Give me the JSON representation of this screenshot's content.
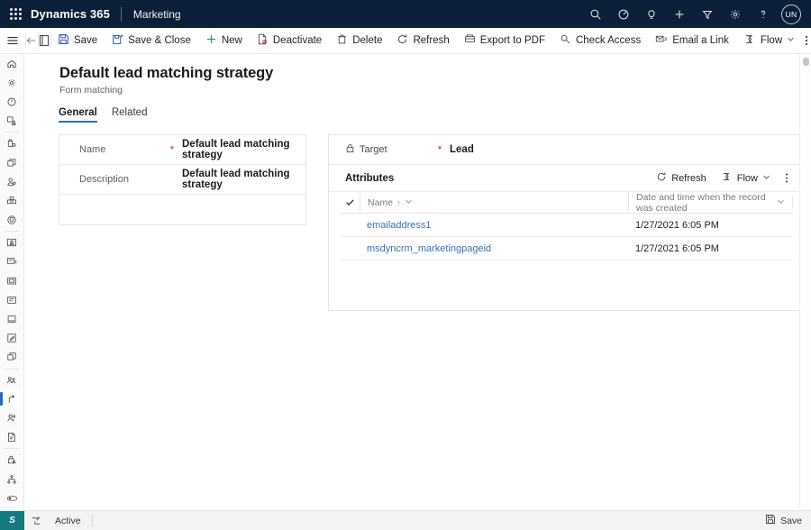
{
  "topnav": {
    "waffle_icon": "app-launcher-icon",
    "brand": "Dynamics 365",
    "app_name": "Marketing",
    "icons": [
      {
        "name": "search-icon",
        "label": "Search"
      },
      {
        "name": "focus-assist-icon",
        "label": "Focused"
      },
      {
        "name": "lightbulb-icon",
        "label": "Assistant"
      },
      {
        "name": "add-icon",
        "label": "New"
      },
      {
        "name": "filter-icon",
        "label": "Filter"
      },
      {
        "name": "settings-gear-icon",
        "label": "Settings"
      },
      {
        "name": "help-question-icon",
        "label": "Help"
      }
    ],
    "avatar_initials": "UN"
  },
  "commandbar": {
    "hamburger_label": "Site map",
    "back_label": "Back",
    "form_icon_label": "Form",
    "buttons": [
      {
        "name": "save-button",
        "label": "Save",
        "icon": "save-icon"
      },
      {
        "name": "save-and-close-button",
        "label": "Save & Close",
        "icon": "save-close-icon"
      },
      {
        "name": "new-button",
        "label": "New",
        "icon": "plus-icon"
      },
      {
        "name": "deactivate-button",
        "label": "Deactivate",
        "icon": "deactivate-icon"
      },
      {
        "name": "delete-button",
        "label": "Delete",
        "icon": "trash-icon"
      },
      {
        "name": "refresh-button",
        "label": "Refresh",
        "icon": "refresh-icon"
      },
      {
        "name": "export-to-pdf-button",
        "label": "Export to PDF",
        "icon": "pdf-icon"
      },
      {
        "name": "check-access-button",
        "label": "Check Access",
        "icon": "key-icon"
      },
      {
        "name": "email-a-link-button",
        "label": "Email a Link",
        "icon": "email-link-icon"
      },
      {
        "name": "flow-button",
        "label": "Flow",
        "icon": "flow-icon",
        "has_chevron": true
      }
    ],
    "overflow_label": "More commands"
  },
  "sidebar": {
    "items": [
      {
        "name": "sidebar-item-home",
        "icon": "home-icon",
        "selected": false
      },
      {
        "name": "sidebar-item-settings",
        "icon": "gear-icon",
        "selected": false
      },
      {
        "name": "sidebar-item-recent",
        "icon": "clock-icon",
        "selected": false
      },
      {
        "name": "sidebar-item-pinned",
        "icon": "pin-person-icon",
        "selected": false
      },
      {
        "name": "sidebar-item-accounts",
        "icon": "briefcase-gear-icon",
        "selected": false,
        "group_start": true
      },
      {
        "name": "sidebar-item-pages",
        "icon": "copy-pages-icon",
        "selected": false
      },
      {
        "name": "sidebar-item-contacts",
        "icon": "person-gear-icon",
        "selected": false
      },
      {
        "name": "sidebar-item-segments",
        "icon": "segments-icon",
        "selected": false
      },
      {
        "name": "sidebar-item-security",
        "icon": "shield-icon",
        "selected": false
      },
      {
        "name": "sidebar-item-customer-journey",
        "icon": "journey-card-icon",
        "selected": false,
        "group_start": true
      },
      {
        "name": "sidebar-item-marketing-email",
        "icon": "email-card-icon",
        "selected": false
      },
      {
        "name": "sidebar-item-marketing-page",
        "icon": "page-card-icon",
        "selected": false
      },
      {
        "name": "sidebar-item-marketing-form",
        "icon": "form-card-icon",
        "selected": false
      },
      {
        "name": "sidebar-item-forms-hosted",
        "icon": "laptop-icon",
        "selected": false
      },
      {
        "name": "sidebar-item-form-editor",
        "icon": "edit-square-icon",
        "selected": false
      },
      {
        "name": "sidebar-item-templates",
        "icon": "layers-icon",
        "selected": false
      },
      {
        "name": "sidebar-item-events",
        "icon": "people-network-icon",
        "selected": false,
        "group_start": true
      },
      {
        "name": "sidebar-item-lead-matching",
        "icon": "branch-arrow-icon",
        "selected": true
      },
      {
        "name": "sidebar-item-leads",
        "icon": "people-search-icon",
        "selected": false
      },
      {
        "name": "sidebar-item-reports",
        "icon": "report-doc-icon",
        "selected": false
      },
      {
        "name": "sidebar-item-data-config",
        "icon": "lock-gear-icon",
        "selected": false,
        "group_start": true
      },
      {
        "name": "sidebar-item-hierarchy",
        "icon": "org-chart-icon",
        "selected": false
      },
      {
        "name": "sidebar-item-toggle",
        "icon": "toggle-icon",
        "selected": false
      }
    ]
  },
  "page": {
    "title": "Default lead matching strategy",
    "subtitle": "Form matching",
    "tabs": [
      {
        "name": "tab-general",
        "label": "General",
        "active": true
      },
      {
        "name": "tab-related",
        "label": "Related",
        "active": false
      }
    ]
  },
  "left_card": {
    "fields": [
      {
        "name": "name-field",
        "label": "Name",
        "required": true,
        "value": "Default lead matching strategy"
      },
      {
        "name": "description-field",
        "label": "Description",
        "required": false,
        "value": "Default lead matching strategy"
      }
    ]
  },
  "right_card": {
    "target": {
      "label": "Target",
      "lock_icon": "lock-icon",
      "required": true,
      "value": "Lead"
    },
    "attributes": {
      "title": "Attributes",
      "actions": [
        {
          "name": "attributes-refresh-button",
          "label": "Refresh",
          "icon": "refresh-icon"
        },
        {
          "name": "attributes-flow-button",
          "label": "Flow",
          "icon": "flow-icon",
          "has_chevron": true
        }
      ],
      "overflow_label": "More commands",
      "grid": {
        "select_all_icon": "checkmark-icon",
        "columns": [
          {
            "name": "column-name",
            "label": "Name",
            "sort": "↑",
            "has_chevron": true
          },
          {
            "name": "column-created-on",
            "label": "Date and time when the record was created",
            "has_chevron": true
          }
        ],
        "rows": [
          {
            "name": "emailaddress1",
            "created": "1/27/2021 6:05 PM"
          },
          {
            "name": "msdyncrm_marketingpageid",
            "created": "1/27/2021 6:05 PM"
          }
        ]
      }
    }
  },
  "statusbar": {
    "badge": "S",
    "status_icon": "record-status-icon",
    "status_text": "Active",
    "save_label": "Save",
    "save_icon": "save-icon"
  },
  "colors": {
    "navy": "#0b2038",
    "accent_blue": "#2b6cd4",
    "link_blue": "#3a6fb5",
    "required_red": "#c0392b",
    "teal_badge": "#137a7f",
    "save_icon_blue": "#2b579a"
  }
}
